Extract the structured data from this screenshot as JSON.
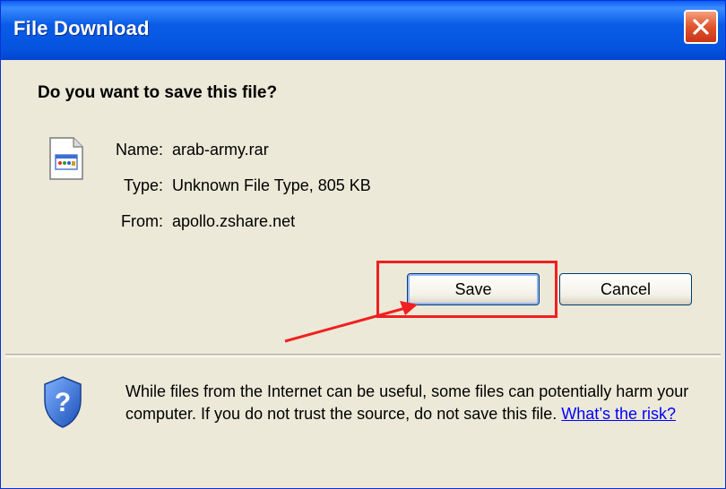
{
  "window": {
    "title": "File Download",
    "close_button_label": "✕"
  },
  "prompt": {
    "question": "Do you want to save this file?"
  },
  "file": {
    "name_label": "Name:",
    "name_value": "arab-army.rar",
    "type_label": "Type:",
    "type_value": "Unknown File Type, 805 KB",
    "from_label": "From:",
    "from_value": "apollo.zshare.net",
    "icon": "unknown-file-icon"
  },
  "buttons": {
    "save_label": "Save",
    "cancel_label": "Cancel"
  },
  "warning": {
    "text": "While files from the Internet can be useful, some files can potentially harm your computer. If you do not trust the source, do not save this file.",
    "link_text": "What’s the risk?",
    "icon": "shield-question-icon"
  },
  "colors": {
    "titlebar": "#0554e0",
    "dialog_bg": "#ece9d8",
    "highlight": "#f02020",
    "link": "#0000ff"
  }
}
